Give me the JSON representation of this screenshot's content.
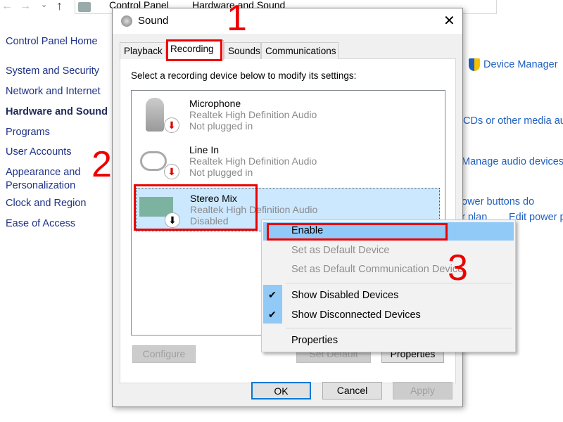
{
  "explorer": {
    "breadcrumb": [
      "Control Panel",
      "Hardware and Sound"
    ]
  },
  "nav": {
    "items": [
      "Control Panel Home",
      "System and Security",
      "Network and Internet",
      "Hardware and Sound",
      "Programs",
      "User Accounts",
      "Appearance and",
      "Personalization",
      "Clock and Region",
      "Ease of Access"
    ]
  },
  "right_links": {
    "device_manager": "Device Manager",
    "autoplay": "CDs or other media au",
    "manage_audio": "Manage audio devices",
    "power_buttons": "ower buttons do",
    "power_plan": "r plan",
    "edit_power": "Edit power p"
  },
  "dialog": {
    "title": "Sound",
    "tabs": [
      "Playback",
      "Recording",
      "Sounds",
      "Communications"
    ],
    "active_tab": "Recording",
    "instruction": "Select a recording device below to modify its settings:",
    "devices": [
      {
        "name": "Microphone",
        "driver": "Realtek High Definition Audio",
        "status": "Not plugged in"
      },
      {
        "name": "Line In",
        "driver": "Realtek High Definition Audio",
        "status": "Not plugged in"
      },
      {
        "name": "Stereo Mix",
        "driver": "Realtek High Definition Audio",
        "status": "Disabled",
        "selected": true
      }
    ],
    "buttons": {
      "configure": "Configure",
      "set_default": "Set Default",
      "properties": "Properties",
      "ok": "OK",
      "cancel": "Cancel",
      "apply": "Apply"
    }
  },
  "context_menu": {
    "items": [
      {
        "label": "Enable",
        "highlighted": true
      },
      {
        "label": "Set as Default Device",
        "disabled": true
      },
      {
        "label": "Set as Default Communication Device",
        "disabled": true
      },
      {
        "label": "Show Disabled Devices",
        "checked": true
      },
      {
        "label": "Show Disconnected Devices",
        "checked": true
      },
      {
        "label": "Properties"
      }
    ]
  },
  "annotations": [
    "1",
    "2",
    "3"
  ],
  "colors": {
    "annotation": "#ee0000",
    "selection": "#cce8ff",
    "menu_highlight": "#91c9f7"
  }
}
